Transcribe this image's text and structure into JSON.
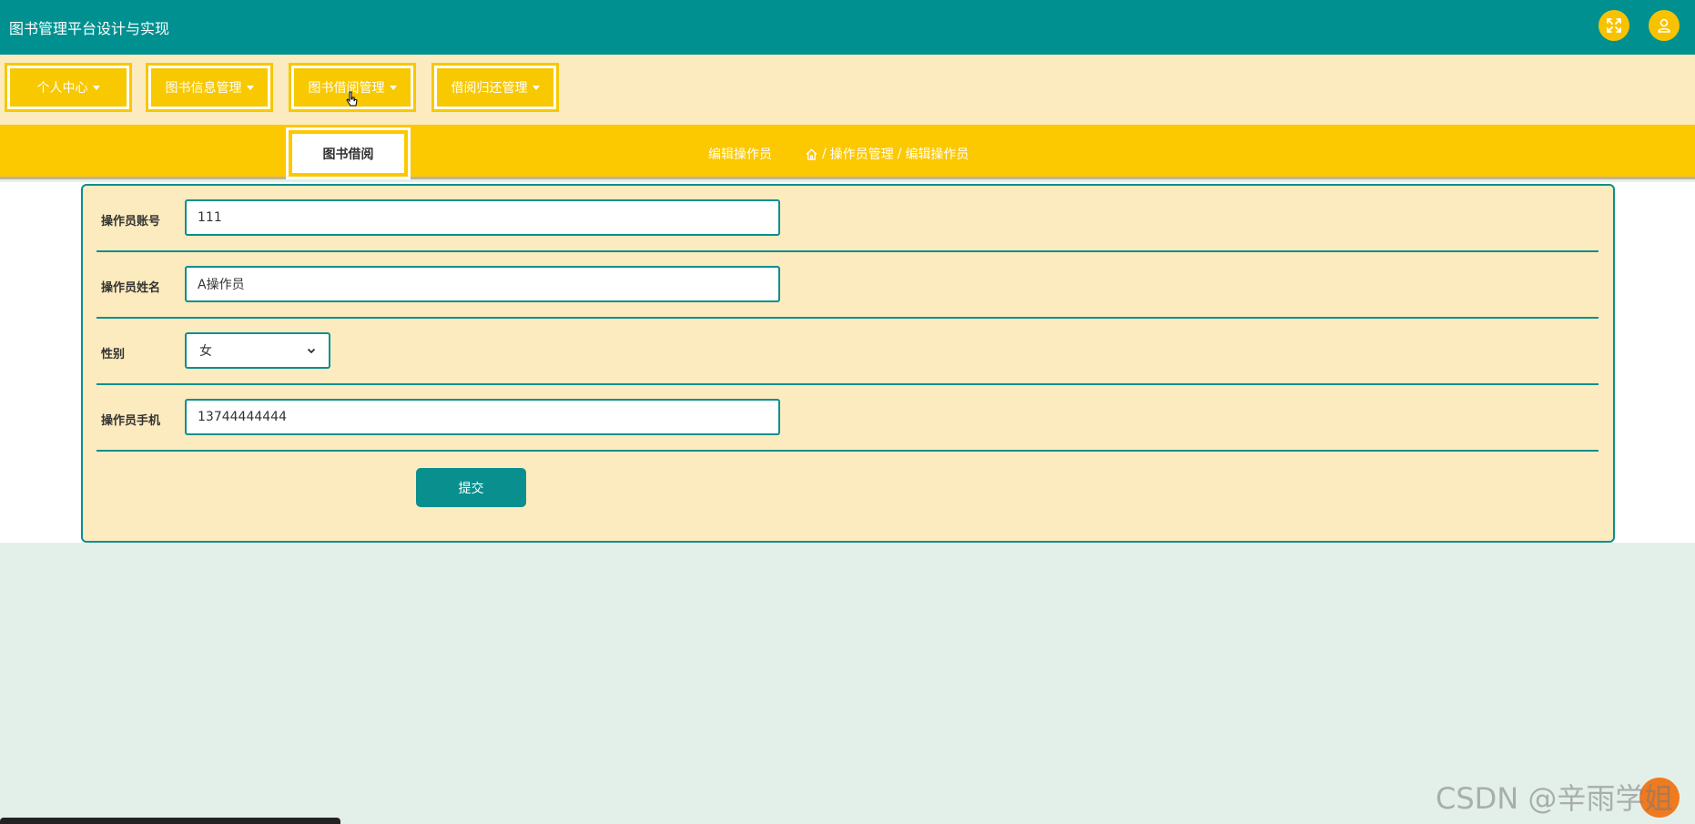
{
  "header": {
    "title": "图书管理平台设计与实现",
    "icons": [
      "fullscreen-icon",
      "user-icon"
    ],
    "background_color": "#009090",
    "icon_color": "#f8c200"
  },
  "menu": {
    "items": [
      {
        "label": "个人中心"
      },
      {
        "label": "图书信息管理"
      },
      {
        "label": "图书借阅管理"
      },
      {
        "label": "借阅归还管理"
      }
    ],
    "dropdown": {
      "items": [
        {
          "label": "图书借阅"
        }
      ]
    }
  },
  "page": {
    "heading": "编辑操作员",
    "breadcrumb": {
      "home_icon": "home-icon",
      "items": [
        "操作员管理",
        "编辑操作员"
      ],
      "separator": "/"
    }
  },
  "form": {
    "fields": [
      {
        "label": "操作员账号",
        "value": "111"
      },
      {
        "label": "操作员姓名",
        "value": "A操作员"
      },
      {
        "label": "性别",
        "value": "女"
      },
      {
        "label": "操作员手机",
        "value": "13744444444"
      }
    ],
    "submit_label": "提交"
  },
  "watermark": "CSDN @辛雨学姐",
  "colors": {
    "accent": "#0a8f8f",
    "menu_yellow": "#f8c800",
    "panel_bg": "#fcebbe",
    "page_bg": "#e3f0ea"
  }
}
